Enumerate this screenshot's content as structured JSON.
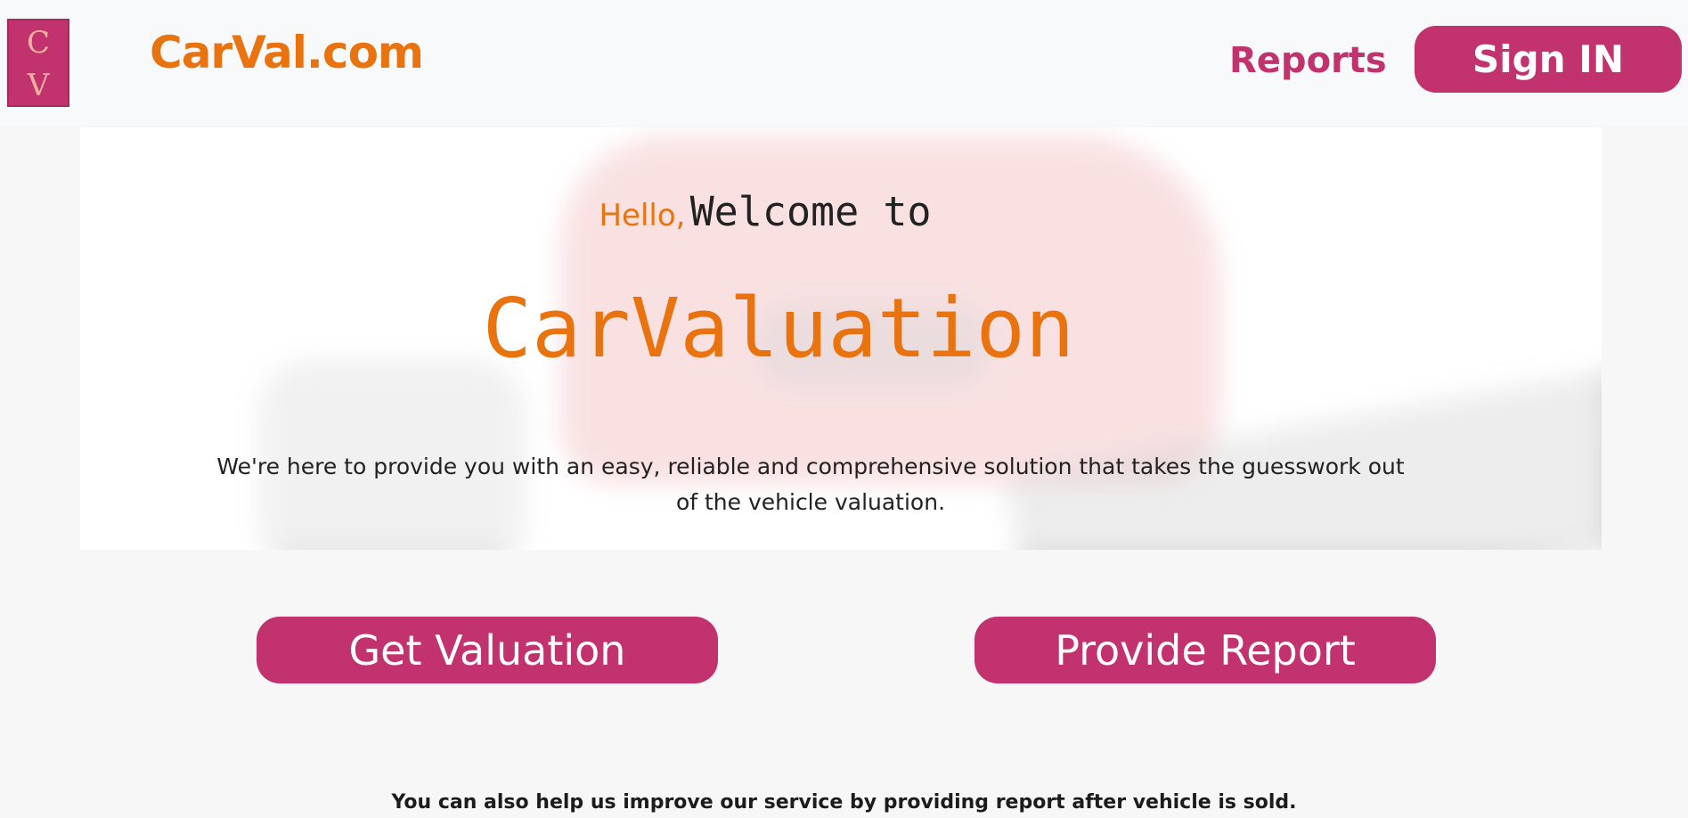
{
  "navbar": {
    "logo": {
      "letters": [
        "C",
        "V"
      ]
    },
    "brand": "CarVal.com",
    "reports_link": "Reports",
    "signin_button": "Sign IN"
  },
  "hero": {
    "greeting_hello": "Hello,",
    "greeting_welcome": "Welcome to",
    "title": "CarValuation",
    "description": "We're here to provide you with an easy, reliable and comprehensive solution that takes the guesswork out of the vehicle valuation."
  },
  "actions": {
    "get_valuation": "Get Valuation",
    "provide_report": "Provide Report"
  },
  "footer_note": "You can also help us improve our service by providing report after vehicle is sold.",
  "colors": {
    "accent_pink": "#c2326f",
    "accent_orange": "#e8730f"
  }
}
